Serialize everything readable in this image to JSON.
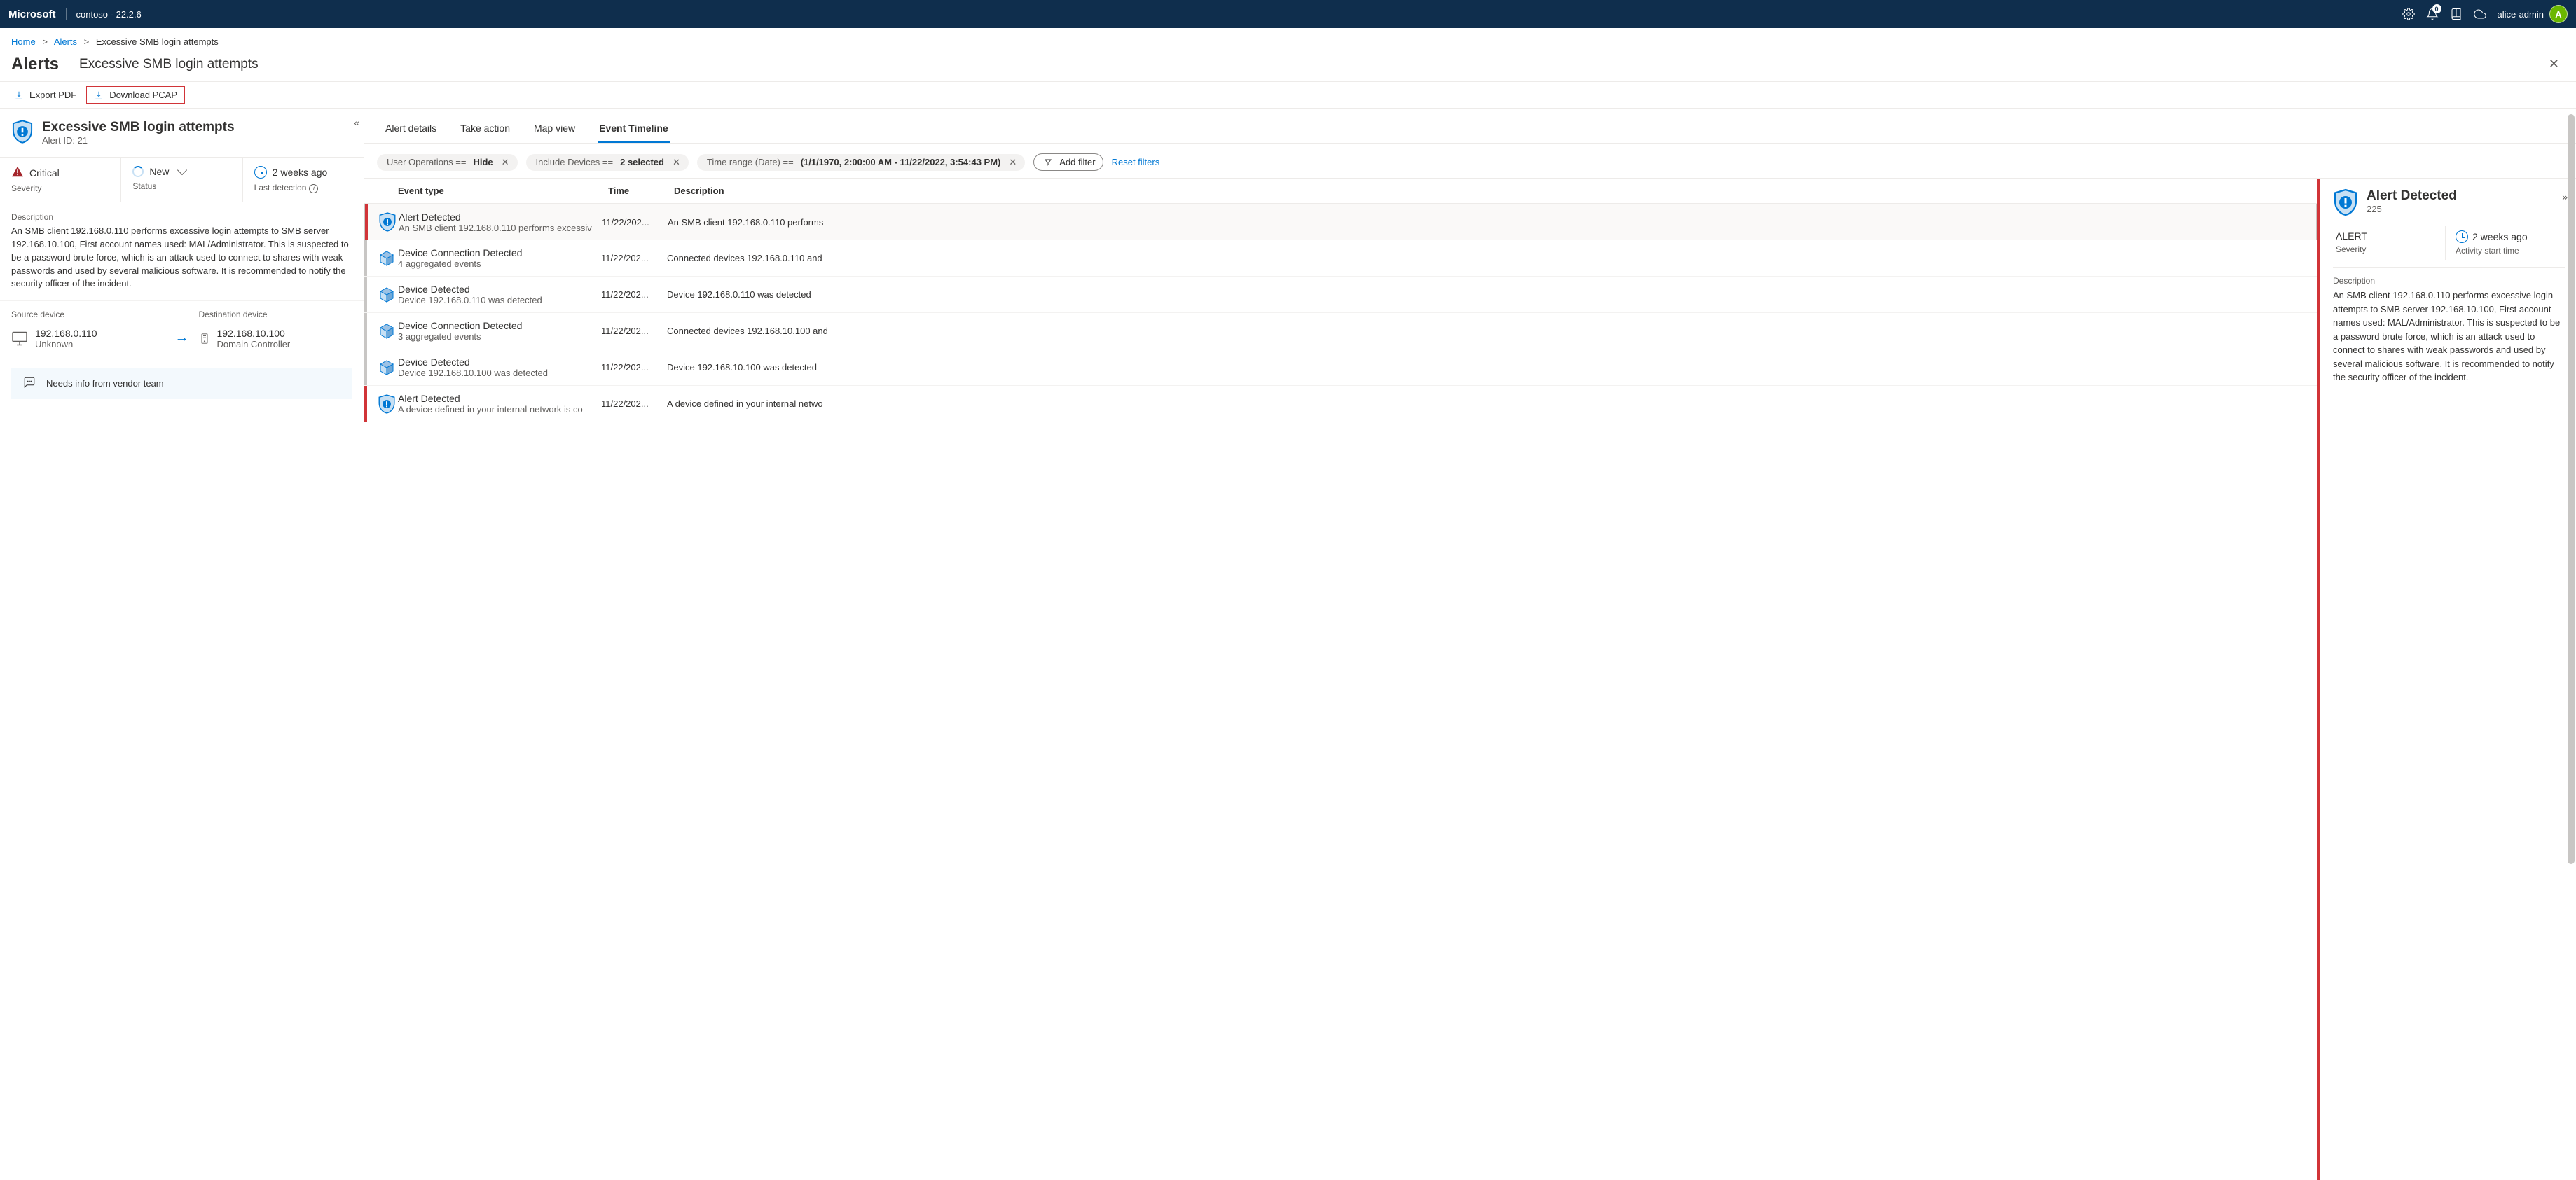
{
  "topbar": {
    "brand": "Microsoft",
    "tenant": "contoso - 22.2.6",
    "notification_count": "0",
    "user_name": "alice-admin",
    "user_initial": "A"
  },
  "breadcrumbs": {
    "items": [
      "Home",
      "Alerts"
    ],
    "current": "Excessive SMB login attempts"
  },
  "page": {
    "title": "Alerts",
    "subtitle": "Excessive SMB login attempts"
  },
  "toolbar": {
    "export_pdf": "Export PDF",
    "download_pcap": "Download PCAP"
  },
  "alert_panel": {
    "title": "Excessive SMB login attempts",
    "id_label": "Alert ID: 21",
    "severity_value": "Critical",
    "severity_label": "Severity",
    "status_value": "New",
    "status_label": "Status",
    "detection_value": "2 weeks ago",
    "detection_label": "Last detection",
    "description_label": "Description",
    "description_text": "An SMB client 192.168.0.110 performs excessive login attempts to SMB server 192.168.10.100, First account names used: MAL/Administrator. This is suspected to be a password brute force, which is an attack used to connect to shares with weak passwords and used by several malicious software. It is recommended to notify the security officer of the incident.",
    "source_label": "Source device",
    "source_ip": "192.168.0.110",
    "source_name": "Unknown",
    "dest_label": "Destination device",
    "dest_ip": "192.168.10.100",
    "dest_name": "Domain Controller",
    "note_text": "Needs info from vendor team"
  },
  "tabs": {
    "items": [
      "Alert details",
      "Take action",
      "Map view",
      "Event Timeline"
    ],
    "active_index": 3
  },
  "filters": {
    "f0_label": "User Operations == ",
    "f0_value": "Hide",
    "f1_label": "Include Devices == ",
    "f1_value": "2 selected",
    "f2_label": "Time range (Date)  ==  ",
    "f2_value": "(1/1/1970, 2:00:00 AM - 11/22/2022, 3:54:43 PM)",
    "add_filter": "Add filter",
    "reset": "Reset filters"
  },
  "table": {
    "headers": {
      "type": "Event type",
      "time": "Time",
      "desc": "Description"
    },
    "rows": [
      {
        "bar": "red",
        "icon": "shield",
        "title": "Alert Detected",
        "sub": "An SMB client 192.168.0.110 performs excessiv",
        "time": "11/22/202...",
        "desc": "An SMB client 192.168.0.110 performs",
        "selected": true
      },
      {
        "bar": "grey",
        "icon": "cube",
        "title": "Device Connection Detected",
        "sub": "4 aggregated events",
        "time": "11/22/202...",
        "desc": "Connected devices 192.168.0.110 and"
      },
      {
        "bar": "grey",
        "icon": "cube",
        "title": "Device Detected",
        "sub": "Device 192.168.0.110 was detected",
        "time": "11/22/202...",
        "desc": "Device 192.168.0.110 was detected"
      },
      {
        "bar": "grey",
        "icon": "cube",
        "title": "Device Connection Detected",
        "sub": "3 aggregated events",
        "time": "11/22/202...",
        "desc": "Connected devices 192.168.10.100 and"
      },
      {
        "bar": "grey",
        "icon": "cube",
        "title": "Device Detected",
        "sub": "Device 192.168.10.100 was detected",
        "time": "11/22/202...",
        "desc": "Device 192.168.10.100 was detected"
      },
      {
        "bar": "red",
        "icon": "shield",
        "title": "Alert Detected",
        "sub": "A device defined in your internal network is co",
        "time": "11/22/202...",
        "desc": "A device defined in your internal netwo"
      }
    ]
  },
  "detail": {
    "title": "Alert Detected",
    "num": "225",
    "severity_value": "ALERT",
    "severity_label": "Severity",
    "start_value": "2 weeks ago",
    "start_label": "Activity start time",
    "desc_label": "Description",
    "desc_text": "An SMB client 192.168.0.110 performs excessive login attempts to SMB server 192.168.10.100, First account names used: MAL/Administrator. This is suspected to be a password brute force, which is an attack used to connect to shares with weak passwords and used by several malicious software. It is recommended to notify the security officer of the incident."
  }
}
